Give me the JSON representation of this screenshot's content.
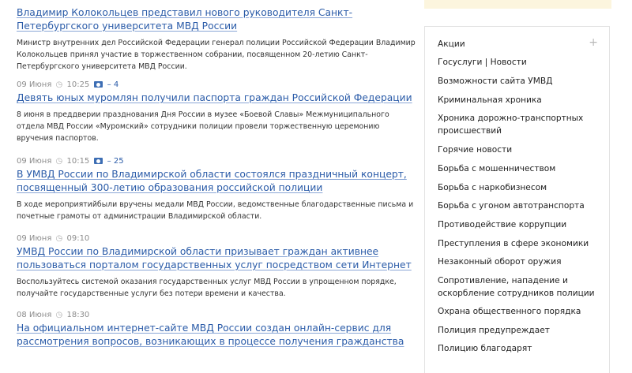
{
  "news": [
    {
      "title": "Владимир Колокольцев представил нового руководителя Санкт-Петербургского университета МВД России",
      "description": "Министр внутренних дел Российской Федерации генерал полиции Российской Федерации Владимир Колокольцев принял участие в торжественном собрании, посвященном 20-летию Санкт-Петербургского университета МВД России."
    },
    {
      "date": "09 Июня",
      "time": "10:25",
      "photo_count": "– 4",
      "title": "Девять юных муромлян получили паспорта граждан Российской Федерации",
      "description": "8 июня в преддверии празднования Дня России в музее «Боевой Славы» Межмуниципального отдела МВД России «Муромский» сотрудники полиции провели торжественную церемонию вручения паспортов."
    },
    {
      "date": "09 Июня",
      "time": "10:15",
      "photo_count": "– 25",
      "title": "В УМВД России по Владимирской области состоялся праздничный концерт, посвященный 300-летию образования российской полиции",
      "description": "В ходе мероприятийбыли вручены медали МВД России, ведомственные благодарственные письма и почетные грамоты от администрации Владимирской области."
    },
    {
      "date": "09 Июня",
      "time": "09:10",
      "title": "УМВД России по Владимирской области призывает граждан активнее пользоваться порталом государственных услуг посредством сети Интернет",
      "description": "Воспользуйтесь системой оказания государственных услуг МВД России в упрощенном порядке, получайте государственные услуги без потери времени и качества."
    },
    {
      "date": "08 Июня",
      "time": "18:30",
      "title": "На официальном интернет-сайте МВД России создан онлайн-сервис для рассмотрения вопросов, возникающих в процессе получения гражданства"
    }
  ],
  "sidebar": {
    "rubrics": [
      "Акции",
      "Госуслуги | Новости",
      "Возможности сайта УМВД",
      "Криминальная хроника",
      "Хроника дорожно-транспортных происшествий",
      "Горячие новости",
      "Борьба с мошенничеством",
      "Борьба с наркобизнесом",
      "Борьба с угоном автотранспорта",
      "Противодействие коррупции",
      "Преступления в сфере экономики",
      "Незаконный оборот оружия",
      "Сопротивление, нападение и оскорбление сотрудников полиции",
      "Охрана общественного порядка",
      "Полиция предупреждает",
      "Полицию благодарят"
    ],
    "expand_symbol": "+"
  }
}
